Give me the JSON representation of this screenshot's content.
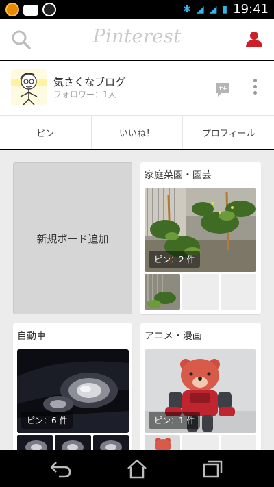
{
  "status": {
    "time": "19:41"
  },
  "app": {
    "logo": "Pinterest"
  },
  "profile": {
    "name": "気さくなブログ",
    "followers": "フォロワー：1人"
  },
  "tabs": [
    {
      "label": "ピン"
    },
    {
      "label": "いいね！"
    },
    {
      "label": "プロフィール"
    }
  ],
  "boards": {
    "add_label": "新規ボード追加",
    "items": [
      {
        "title": "家庭菜園・園芸",
        "pins": "ピン：2 件"
      },
      {
        "title": "自動車",
        "pins": "ピン：6 件"
      },
      {
        "title": "アニメ・漫画",
        "pins": "ピン：1 件"
      }
    ]
  },
  "colors": {
    "accent": "#cb2027",
    "tab_bg": "#ffffff",
    "content_bg": "#ececec"
  },
  "icons": {
    "search": "search-icon",
    "user": "user-icon",
    "message": "message-icon",
    "more": "more-vert-icon",
    "back": "back-icon",
    "home": "home-icon",
    "recents": "recents-icon"
  }
}
